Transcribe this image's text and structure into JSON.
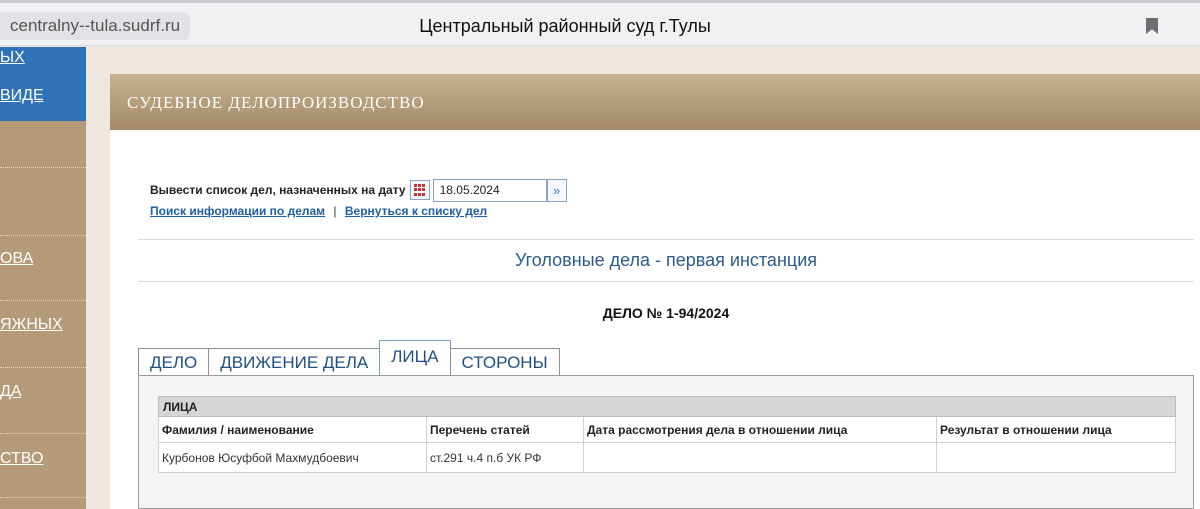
{
  "browser": {
    "domain": "centralny--tula.sudrf.ru",
    "page_title": "Центральный районный суд г.Тулы"
  },
  "sidebar": {
    "items": [
      {
        "label": "ЫХ"
      },
      {
        "label": "ВИДЕ"
      },
      {
        "label": "ОВА"
      },
      {
        "label": "ЯЖНЫХ"
      },
      {
        "label": "ДА"
      },
      {
        "label": "СТВО"
      }
    ]
  },
  "banner": {
    "title": "СУДЕБНОЕ ДЕЛОПРОИЗВОДСТВО"
  },
  "date_filter": {
    "label": "Вывести список дел, назначенных на дату",
    "value": "18.05.2024",
    "calendar_icon": "calendar-icon",
    "go_icon": "double-chevron-right-icon"
  },
  "links": {
    "search": "Поиск информации по делам",
    "separator": "|",
    "back": "Вернуться к списку дел"
  },
  "section_title": "Уголовные дела - первая инстанция",
  "case_number": "ДЕЛО № 1-94/2024",
  "tabs": [
    {
      "label": "ДЕЛО"
    },
    {
      "label": "ДВИЖЕНИЕ ДЕЛА"
    },
    {
      "label": "ЛИЦА"
    },
    {
      "label": "СТОРОНЫ"
    }
  ],
  "persons_table": {
    "caption": "ЛИЦА",
    "columns": [
      "Фамилия / наименование",
      "Перечень статей",
      "Дата рассмотрения дела в отношении лица",
      "Результат в отношении лица"
    ],
    "rows": [
      [
        "Курбонов Юсуфбой Махмудбоевич",
        "ст.291 ч.4 п.б УК РФ",
        "",
        ""
      ]
    ]
  },
  "colors": {
    "sidebar_bg": "#b59a77",
    "sidebar_active": "#2f72b8",
    "banner": "#a38966",
    "link": "#1f5fa8"
  }
}
